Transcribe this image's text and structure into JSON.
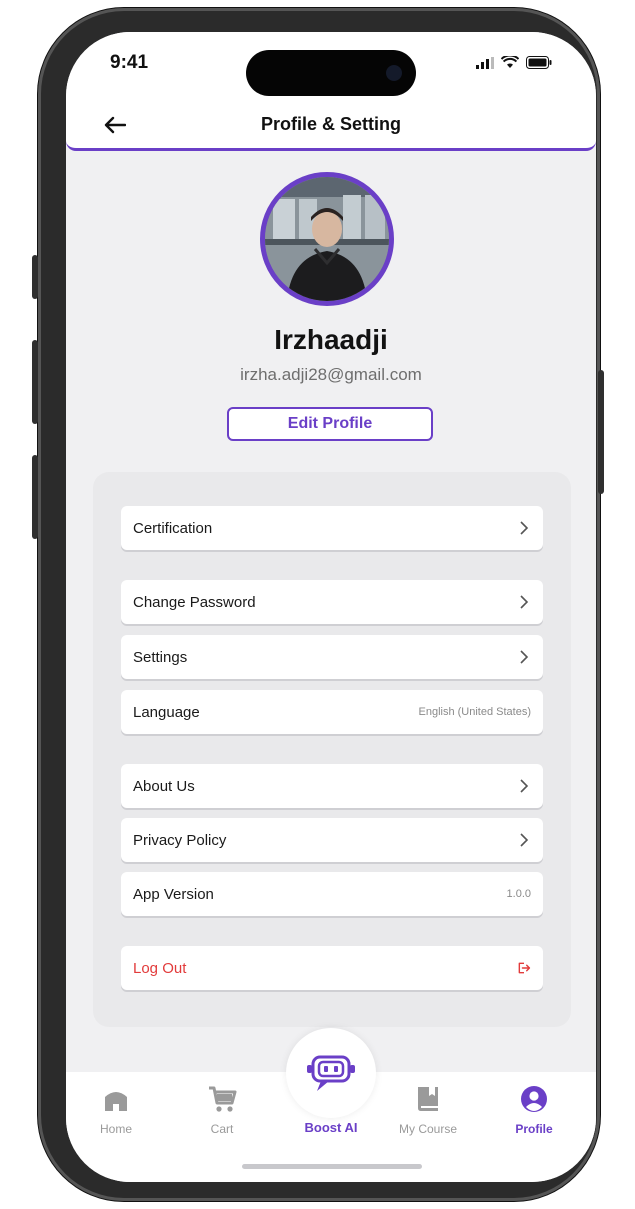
{
  "status_bar": {
    "time": "9:41"
  },
  "header": {
    "title": "Profile & Setting"
  },
  "profile": {
    "name": "Irzhaadji",
    "email": "irzha.adji28@gmail.com",
    "edit_button": "Edit Profile"
  },
  "menu": {
    "certification": "Certification",
    "change_password": "Change Password",
    "settings": "Settings",
    "language": "Language",
    "language_value": "English (United States)",
    "about_us": "About Us",
    "privacy_policy": "Privacy Policy",
    "app_version": "App Version",
    "app_version_value": "1.0.0",
    "log_out": "Log Out"
  },
  "bottom_nav": {
    "home": "Home",
    "cart": "Cart",
    "boost_ai": "Boost AI",
    "my_course": "My Course",
    "profile": "Profile",
    "active": "Profile"
  },
  "colors": {
    "accent": "#6a3fc7",
    "danger": "#e23b3b",
    "background": "#f0f0f2"
  },
  "icons": [
    "back-arrow-icon",
    "signal-icon",
    "wifi-icon",
    "battery-icon",
    "chevron-right-icon",
    "logout-icon",
    "home-icon",
    "cart-icon",
    "robot-icon",
    "book-icon",
    "profile-icon"
  ]
}
